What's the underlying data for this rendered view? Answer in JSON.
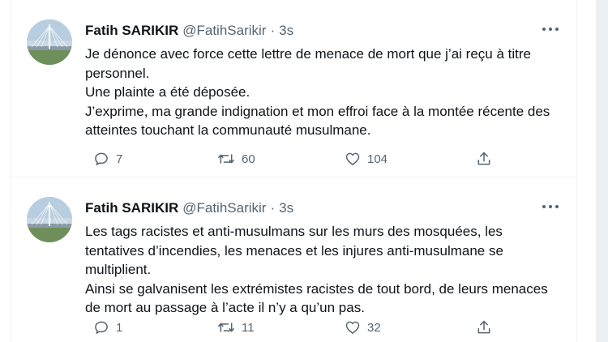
{
  "tweets": [
    {
      "author_name": "Fatih SARIKIR",
      "handle": "@FatihSarikir",
      "separator": "·",
      "time": "3s",
      "text_lines": [
        "Je dénonce avec force cette lettre de menace de mort que j’ai reçu à titre",
        "personnel.",
        "Une plainte a été déposée.",
        "J’exprime, ma grande indignation et mon effroi face à la montée récente des",
        "atteintes touchant la communauté musulmane."
      ],
      "replies": "7",
      "retweets": "60",
      "likes": "104"
    },
    {
      "author_name": "Fatih SARIKIR",
      "handle": "@FatihSarikir",
      "separator": "·",
      "time": "3s",
      "text_lines": [
        "Les tags racistes et anti-musulmans sur les murs des mosquées, les",
        "tentatives d’incendies, les menaces et les injures anti-musulmane se",
        "multiplient.",
        "Ainsi se galvanisent les extrémistes racistes de tout bord, de leurs menaces",
        "de mort au passage à l’acte il n’y a qu’un pas."
      ],
      "replies": "1",
      "retweets": "11",
      "likes": "32"
    }
  ],
  "icons": {
    "reply": "reply-icon",
    "retweet": "retweet-icon",
    "like": "like-icon",
    "share": "share-icon",
    "more": "more-icon"
  },
  "colors": {
    "text": "#0f1419",
    "secondary": "#536471",
    "border": "#eff3f4"
  }
}
